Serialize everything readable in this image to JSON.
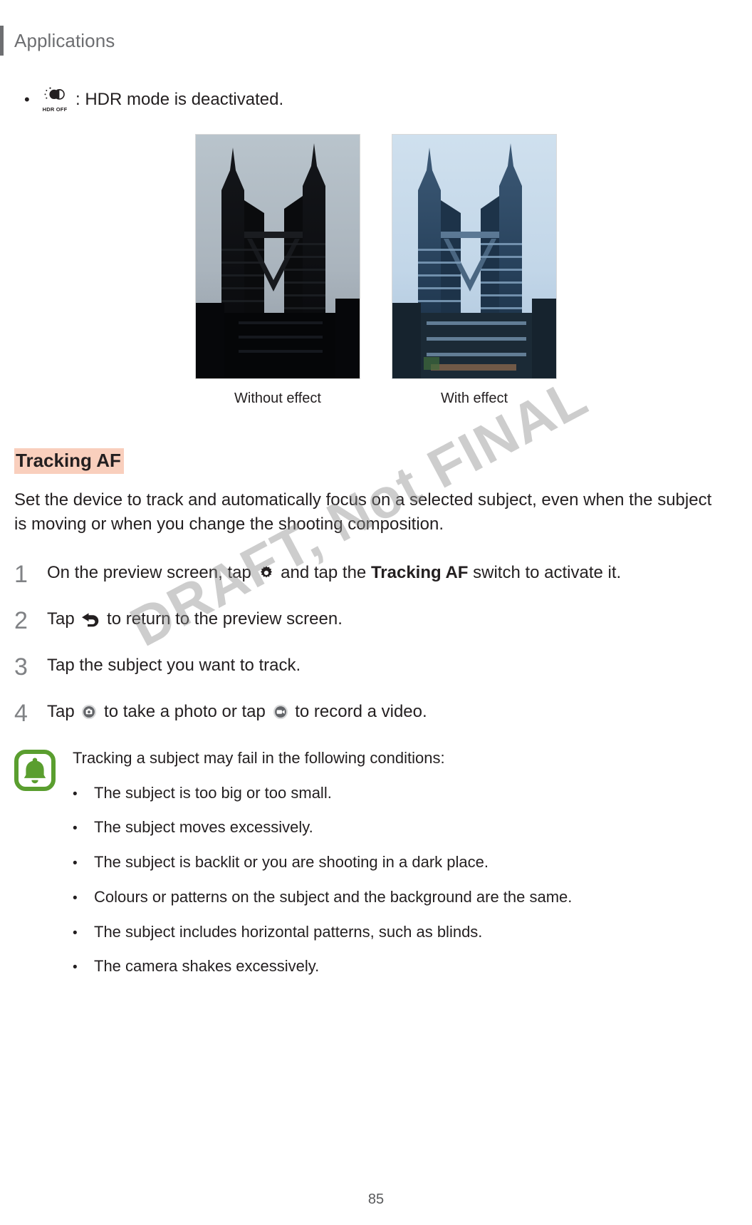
{
  "header": {
    "title": "Applications"
  },
  "hdr_bullet": {
    "icon": "hdr-off-icon",
    "icon_label": "HDR OFF",
    "text": ": HDR mode is deactivated."
  },
  "comparison": {
    "left": {
      "caption": "Without effect",
      "image": "petronas-towers-photo-dark"
    },
    "right": {
      "caption": "With effect",
      "image": "petronas-towers-photo-hdr"
    }
  },
  "section": {
    "heading": "Tracking AF",
    "highlight_color": "#f9cfbd",
    "intro": "Set the device to track and automatically focus on a selected subject, even when the subject is moving or when you change the shooting composition."
  },
  "steps": [
    {
      "number": "1",
      "pre": "On the preview screen, tap",
      "icon": "gear-icon",
      "mid": "and tap the",
      "bold": "Tracking AF",
      "post": "switch to activate it."
    },
    {
      "number": "2",
      "pre": "Tap",
      "icon": "back-arrow-icon",
      "mid": "",
      "bold": "",
      "post": "to return to the preview screen."
    },
    {
      "number": "3",
      "pre": "Tap the subject you want to track.",
      "icon": "",
      "mid": "",
      "bold": "",
      "post": ""
    },
    {
      "number": "4",
      "pre": "Tap",
      "icon": "camera-shutter-icon",
      "mid": "to take a photo or tap",
      "icon2": "camcorder-icon",
      "bold": "",
      "post": "to record a video."
    }
  ],
  "note": {
    "icon": "bell-icon",
    "icon_color": "#5a9e2f",
    "lead": "Tracking a subject may fail in the following conditions:",
    "items": [
      "The subject is too big or too small.",
      "The subject moves excessively.",
      "The subject is backlit or you are shooting in a dark place.",
      "Colours or patterns on the subject and the background are the same.",
      "The subject includes horizontal patterns, such as blinds.",
      "The camera shakes excessively."
    ]
  },
  "footer": {
    "page_number": "85"
  },
  "watermark": {
    "text": "DRAFT, Not FINAL"
  }
}
